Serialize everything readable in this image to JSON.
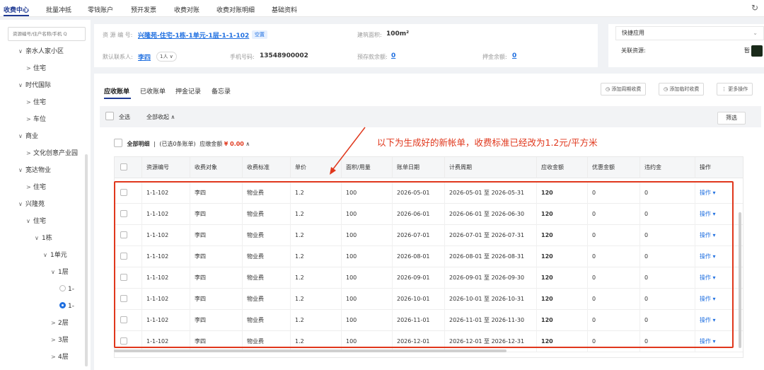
{
  "topnav": {
    "tabs": [
      "收费中心",
      "批量冲抵",
      "零钱账户",
      "预开发票",
      "收费对账",
      "收费对账明细",
      "基础资料"
    ]
  },
  "sidebar": {
    "search_placeholder": "资源编号/住户名称/手机 Q",
    "items": [
      {
        "label": "亲水人家小区",
        "level": 0,
        "arrow": "∨"
      },
      {
        "label": "住宅",
        "level": 1,
        "arrow": ">"
      },
      {
        "label": "时代国际",
        "level": 0,
        "arrow": "∨"
      },
      {
        "label": "住宅",
        "level": 1,
        "arrow": ">"
      },
      {
        "label": "车位",
        "level": 1,
        "arrow": ">"
      },
      {
        "label": "商业",
        "level": 0,
        "arrow": "∨"
      },
      {
        "label": "文化创意产业园",
        "level": 1,
        "arrow": ">"
      },
      {
        "label": "宽达物业",
        "level": 0,
        "arrow": "∨"
      },
      {
        "label": "住宅",
        "level": 1,
        "arrow": ">"
      },
      {
        "label": "兴隆苑",
        "level": 0,
        "arrow": "∨"
      },
      {
        "label": "住宅",
        "level": 1,
        "arrow": "∨"
      },
      {
        "label": "1栋",
        "level": 2,
        "arrow": "∨"
      },
      {
        "label": "1单元",
        "level": 3,
        "arrow": "∨"
      },
      {
        "label": "1层",
        "level": 4,
        "arrow": "∨"
      },
      {
        "label": "1-",
        "level": 5,
        "arrow": "radio"
      },
      {
        "label": "1-",
        "level": 5,
        "arrow": "radio-on"
      },
      {
        "label": "2层",
        "level": 4,
        "arrow": ">"
      },
      {
        "label": "3层",
        "level": 4,
        "arrow": ">"
      },
      {
        "label": "4层",
        "level": 4,
        "arrow": ">"
      }
    ]
  },
  "info": {
    "resource_label": "资 源 编 号:",
    "resource_value": "兴隆苑-住宅-1栋-1单元-1层-1-1-102",
    "status_badge": "空置",
    "area_label": "建筑面积:",
    "area_value": "100m²",
    "contact_label": "默认联系人:",
    "contact_value": "李四",
    "contact_count": "1人 ∨",
    "phone_label": "手机号码:",
    "phone_value": "13548900002",
    "prepay_label": "预存款余额:",
    "prepay_value": "0",
    "deposit_label": "押金余额:",
    "deposit_value": "0"
  },
  "quick": {
    "quick_apps": "快捷应用",
    "related": "关联资源:",
    "related_value": "暂"
  },
  "main": {
    "tabs": [
      "应收账单",
      "已收账单",
      "押金记录",
      "备忘录"
    ],
    "buttons": [
      "添加周期收费",
      "添加临时收费",
      "更多操作"
    ],
    "select_all": "全选",
    "collapse_all": "全部收起 ∧",
    "filter": "筛选",
    "summary_label": "全部明细",
    "summary_selected": "(已选0条账单)",
    "summary_due": "应缴金额",
    "summary_amount": "¥ 0.00",
    "annotation": "以下为生成好的新帐单，收费标准已经改为1.2元/平方米"
  },
  "table": {
    "headers": [
      "资源编号",
      "收费对象",
      "收费标准",
      "单价",
      "面积/用量",
      "账单日期",
      "计费周期",
      "应收金额",
      "优惠金额",
      "违约金",
      "操作"
    ],
    "rows": [
      [
        "1-1-102",
        "李四",
        "物业费",
        "1.2",
        "100",
        "2026-05-01",
        "2026-05-01 至 2026-05-31",
        "120",
        "0",
        "0",
        "操作 ▾"
      ],
      [
        "1-1-102",
        "李四",
        "物业费",
        "1.2",
        "100",
        "2026-06-01",
        "2026-06-01 至 2026-06-30",
        "120",
        "0",
        "0",
        "操作 ▾"
      ],
      [
        "1-1-102",
        "李四",
        "物业费",
        "1.2",
        "100",
        "2026-07-01",
        "2026-07-01 至 2026-07-31",
        "120",
        "0",
        "0",
        "操作 ▾"
      ],
      [
        "1-1-102",
        "李四",
        "物业费",
        "1.2",
        "100",
        "2026-08-01",
        "2026-08-01 至 2026-08-31",
        "120",
        "0",
        "0",
        "操作 ▾"
      ],
      [
        "1-1-102",
        "李四",
        "物业费",
        "1.2",
        "100",
        "2026-09-01",
        "2026-09-01 至 2026-09-30",
        "120",
        "0",
        "0",
        "操作 ▾"
      ],
      [
        "1-1-102",
        "李四",
        "物业费",
        "1.2",
        "100",
        "2026-10-01",
        "2026-10-01 至 2026-10-31",
        "120",
        "0",
        "0",
        "操作 ▾"
      ],
      [
        "1-1-102",
        "李四",
        "物业费",
        "1.2",
        "100",
        "2026-11-01",
        "2026-11-01 至 2026-11-30",
        "120",
        "0",
        "0",
        "操作 ▾"
      ],
      [
        "1-1-102",
        "李四",
        "物业费",
        "1.2",
        "100",
        "2026-12-01",
        "2026-12-01 至 2026-12-31",
        "120",
        "0",
        "0",
        "操作 ▾"
      ]
    ]
  }
}
